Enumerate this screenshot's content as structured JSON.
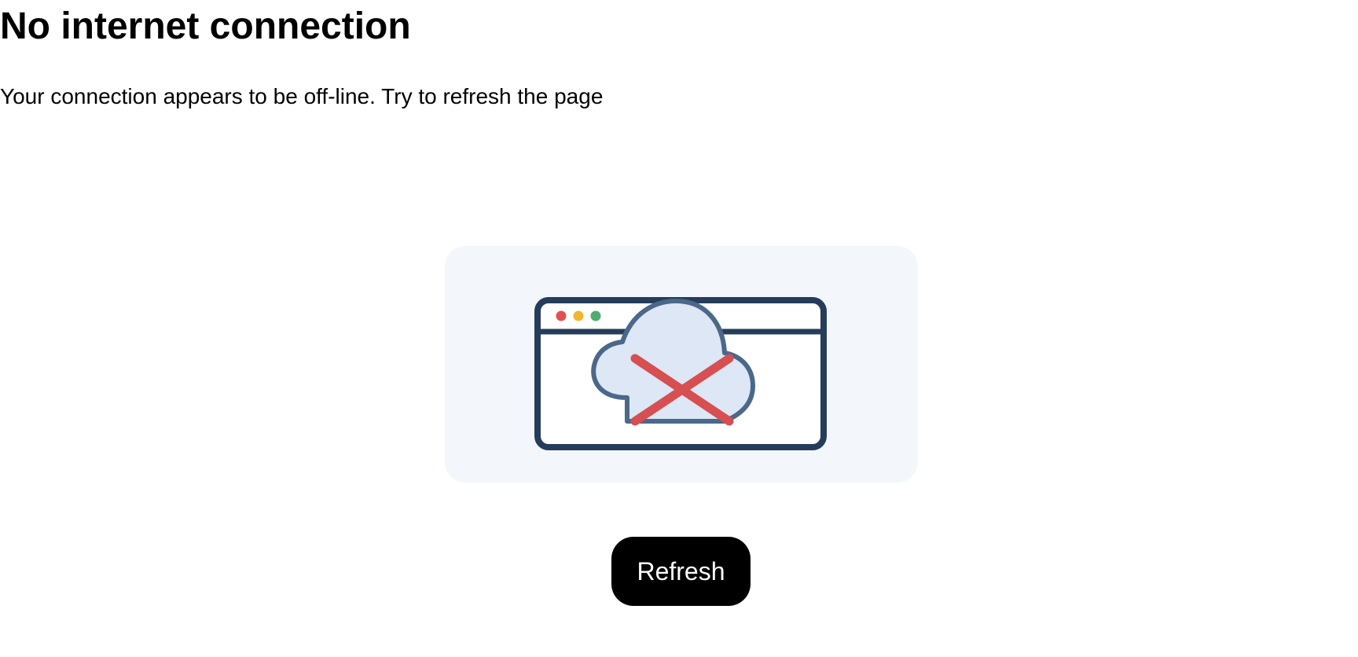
{
  "page": {
    "title": "No internet connection",
    "message": "Your connection appears to be off-line. Try to refresh the page"
  },
  "illustration": {
    "icon": "offline-browser-cloud-icon",
    "colors": {
      "panel_background": "#f3f6fb",
      "window_stroke": "#253d5b",
      "cloud_fill": "#dde7f5",
      "cloud_stroke": "#4b6889",
      "cross": "#d64f51",
      "dot_red": "#e05252",
      "dot_yellow": "#f2b632",
      "dot_green": "#4ead6a"
    }
  },
  "refresh_button": {
    "label": "Refresh"
  }
}
